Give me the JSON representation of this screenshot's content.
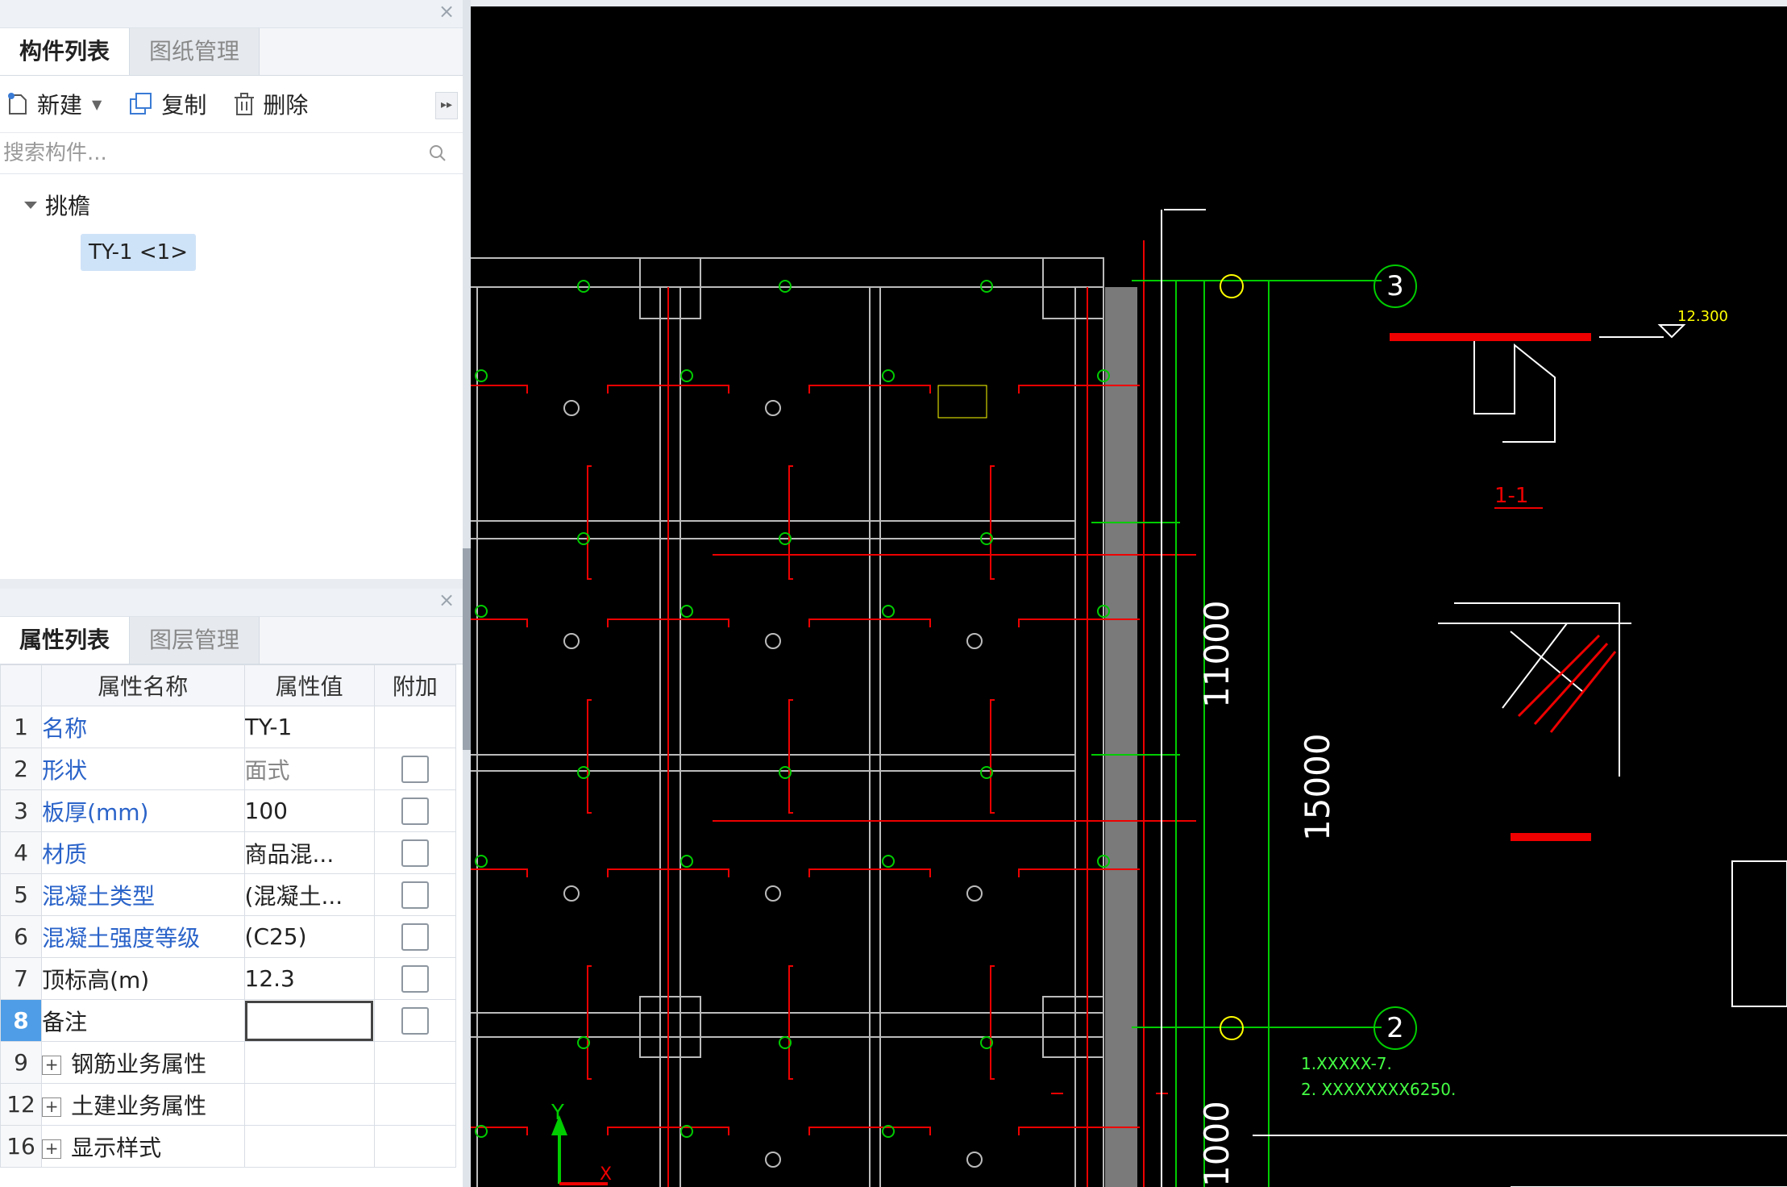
{
  "component_panel": {
    "tabs": [
      "构件列表",
      "图纸管理"
    ],
    "toolbar": {
      "new": "新建",
      "copy": "复制",
      "delete": "删除"
    },
    "search_placeholder": "搜索构件...",
    "tree": {
      "group": "挑檐",
      "item": "TY-1 <1>"
    }
  },
  "property_panel": {
    "tabs": [
      "属性列表",
      "图层管理"
    ],
    "columns": [
      "属性名称",
      "属性值",
      "附加"
    ],
    "rows": [
      {
        "num": "1",
        "name": "名称",
        "value": "TY-1"
      },
      {
        "num": "2",
        "name": "形状",
        "value": "面式"
      },
      {
        "num": "3",
        "name": "板厚(mm)",
        "value": "100"
      },
      {
        "num": "4",
        "name": "材质",
        "value": "商品混..."
      },
      {
        "num": "5",
        "name": "混凝土类型",
        "value": "(混凝土..."
      },
      {
        "num": "6",
        "name": "混凝土强度等级",
        "value": "(C25)"
      },
      {
        "num": "7",
        "name": "顶标高(m)",
        "value": "12.3"
      },
      {
        "num": "8",
        "name": "备注",
        "value": ""
      },
      {
        "num": "9",
        "name": "钢筋业务属性",
        "value": ""
      },
      {
        "num": "12",
        "name": "土建业务属性",
        "value": ""
      },
      {
        "num": "16",
        "name": "显示样式",
        "value": ""
      }
    ]
  },
  "drawing": {
    "axis_labels": [
      "3",
      "2"
    ],
    "dimensions": [
      "11000",
      "15000",
      "1000"
    ],
    "section_label": "1-1",
    "elevation": "12.300",
    "notes": [
      "1.XXXXX-7.",
      "2. XXXXXXXX6250."
    ],
    "axis_y": "Y",
    "axis_x": "X"
  }
}
